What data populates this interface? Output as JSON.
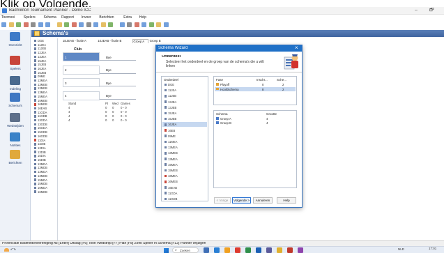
{
  "caption": "Klik op Volgende.",
  "window": {
    "title": "Badminton Tournament Planner - Demo ICC",
    "minimize": "–",
    "restore": "🗗"
  },
  "menu": [
    "Toernooi",
    "Spelers",
    "Schema",
    "Rapport",
    "Invoer",
    "Berichten",
    "Extra",
    "Help"
  ],
  "header_title": "Schema's",
  "sidebar": [
    {
      "label": "Overzicht",
      "icon": "globe-icon"
    },
    {
      "label": "Spelers",
      "icon": "players-icon"
    },
    {
      "label": "Indeling",
      "icon": "layout-icon"
    },
    {
      "label": "Schema's",
      "icon": "schema-icon"
    },
    {
      "label": "Wedstrijden",
      "icon": "shuttle-icon"
    },
    {
      "label": "Notities",
      "icon": "notes-icon"
    },
    {
      "label": "Berichten",
      "icon": "messages-icon"
    }
  ],
  "event_list": [
    "DGE",
    "11JEA",
    "11JEB",
    "12JEA",
    "13JEA",
    "15JEA",
    "15JEB",
    "16JEA",
    "16JEB",
    "09ME",
    "13MEA",
    "13MEB",
    "13MEB",
    "13MEA",
    "15MEA",
    "15MEB",
    "16MEB",
    "16EAB",
    "11GDA",
    "11GDB",
    "13GDA",
    "13GDB",
    "15GDA",
    "15GDB",
    "16GDB",
    "11DIA",
    "11DIB",
    "13DIA",
    "13DIB",
    "15DIA",
    "15DIB",
    "13MDA",
    "13MDB",
    "13MDA",
    "13MDB",
    "15MDA",
    "15MDB",
    "16MDA",
    "16MDB"
  ],
  "tabs": [
    "1EJEAB - finale A",
    "1EJEAB - finale B",
    "Groep A",
    "Groep B"
  ],
  "draw": {
    "club_header": "Club",
    "rows": [
      {
        "num": "1",
        "bye": "Bye"
      },
      {
        "num": "2",
        "bye": "Bye"
      },
      {
        "num": "3",
        "bye": "Bye"
      },
      {
        "num": "4",
        "bye": "Bye"
      }
    ]
  },
  "standings": {
    "headers": [
      "Stand",
      "Pt",
      "Wed",
      "Games"
    ],
    "rows": [
      [
        "4",
        "0",
        "0",
        "0 - 0"
      ],
      [
        "4",
        "0",
        "0",
        "0 - 0"
      ],
      [
        "4",
        "0",
        "0",
        "0 - 0"
      ],
      [
        "4",
        "0",
        "0",
        "0 - 0"
      ]
    ]
  },
  "dialog": {
    "title": "Schema Wizard",
    "close": "×",
    "subtitle": "Onderdeel",
    "description": "Selecteer het onderdeel en de groep van de schema's die u wilt linken",
    "list_header": "Onderdeel",
    "list": [
      "DGE",
      "11JEA",
      "11JEB",
      "13JEA",
      "13JEB",
      "15JEA",
      "15JEB",
      "16JEA",
      "16EB",
      "09ME",
      "11MEA",
      "13MEA",
      "13MEB",
      "13MEA",
      "15MEA",
      "15MEB",
      "16MEA",
      "16MEB",
      "16EAB",
      "11GDA",
      "11GDB"
    ],
    "selected_index": 7,
    "fase": {
      "headers": [
        "Fase",
        "Inschr...",
        "Sche..."
      ],
      "rows": [
        [
          "Playoff",
          "0",
          "2"
        ],
        [
          "Hoofdschema",
          "8",
          "2"
        ]
      ],
      "selected_index": 1
    },
    "schema": {
      "headers": [
        "Schema",
        "Grootte"
      ],
      "rows": [
        [
          "Groep A",
          "4"
        ],
        [
          "Groep B",
          "4"
        ]
      ]
    },
    "buttons": {
      "back": "< Vorige",
      "next": "Volgende >",
      "cancel": "Annuleren",
      "help": "Help"
    }
  },
  "status_bar": "Provinciale Badmintonvereniging Az   [Enter] Uitslag [F6] Toon Wedstrijd [F7] Plan [F8] Zoek Speler in Schema [F12] Partner Wijzigen",
  "taskbar": {
    "weather": "2°C",
    "search": "Zoeken",
    "time": "17:01",
    "date": "27-02-2023",
    "lang": "NLD"
  },
  "colors": {
    "header_bar": "#4a6fa5",
    "dialog_title": "#1e6fc4",
    "selection": "#c6d8f0",
    "accent": "#3a78c8"
  }
}
